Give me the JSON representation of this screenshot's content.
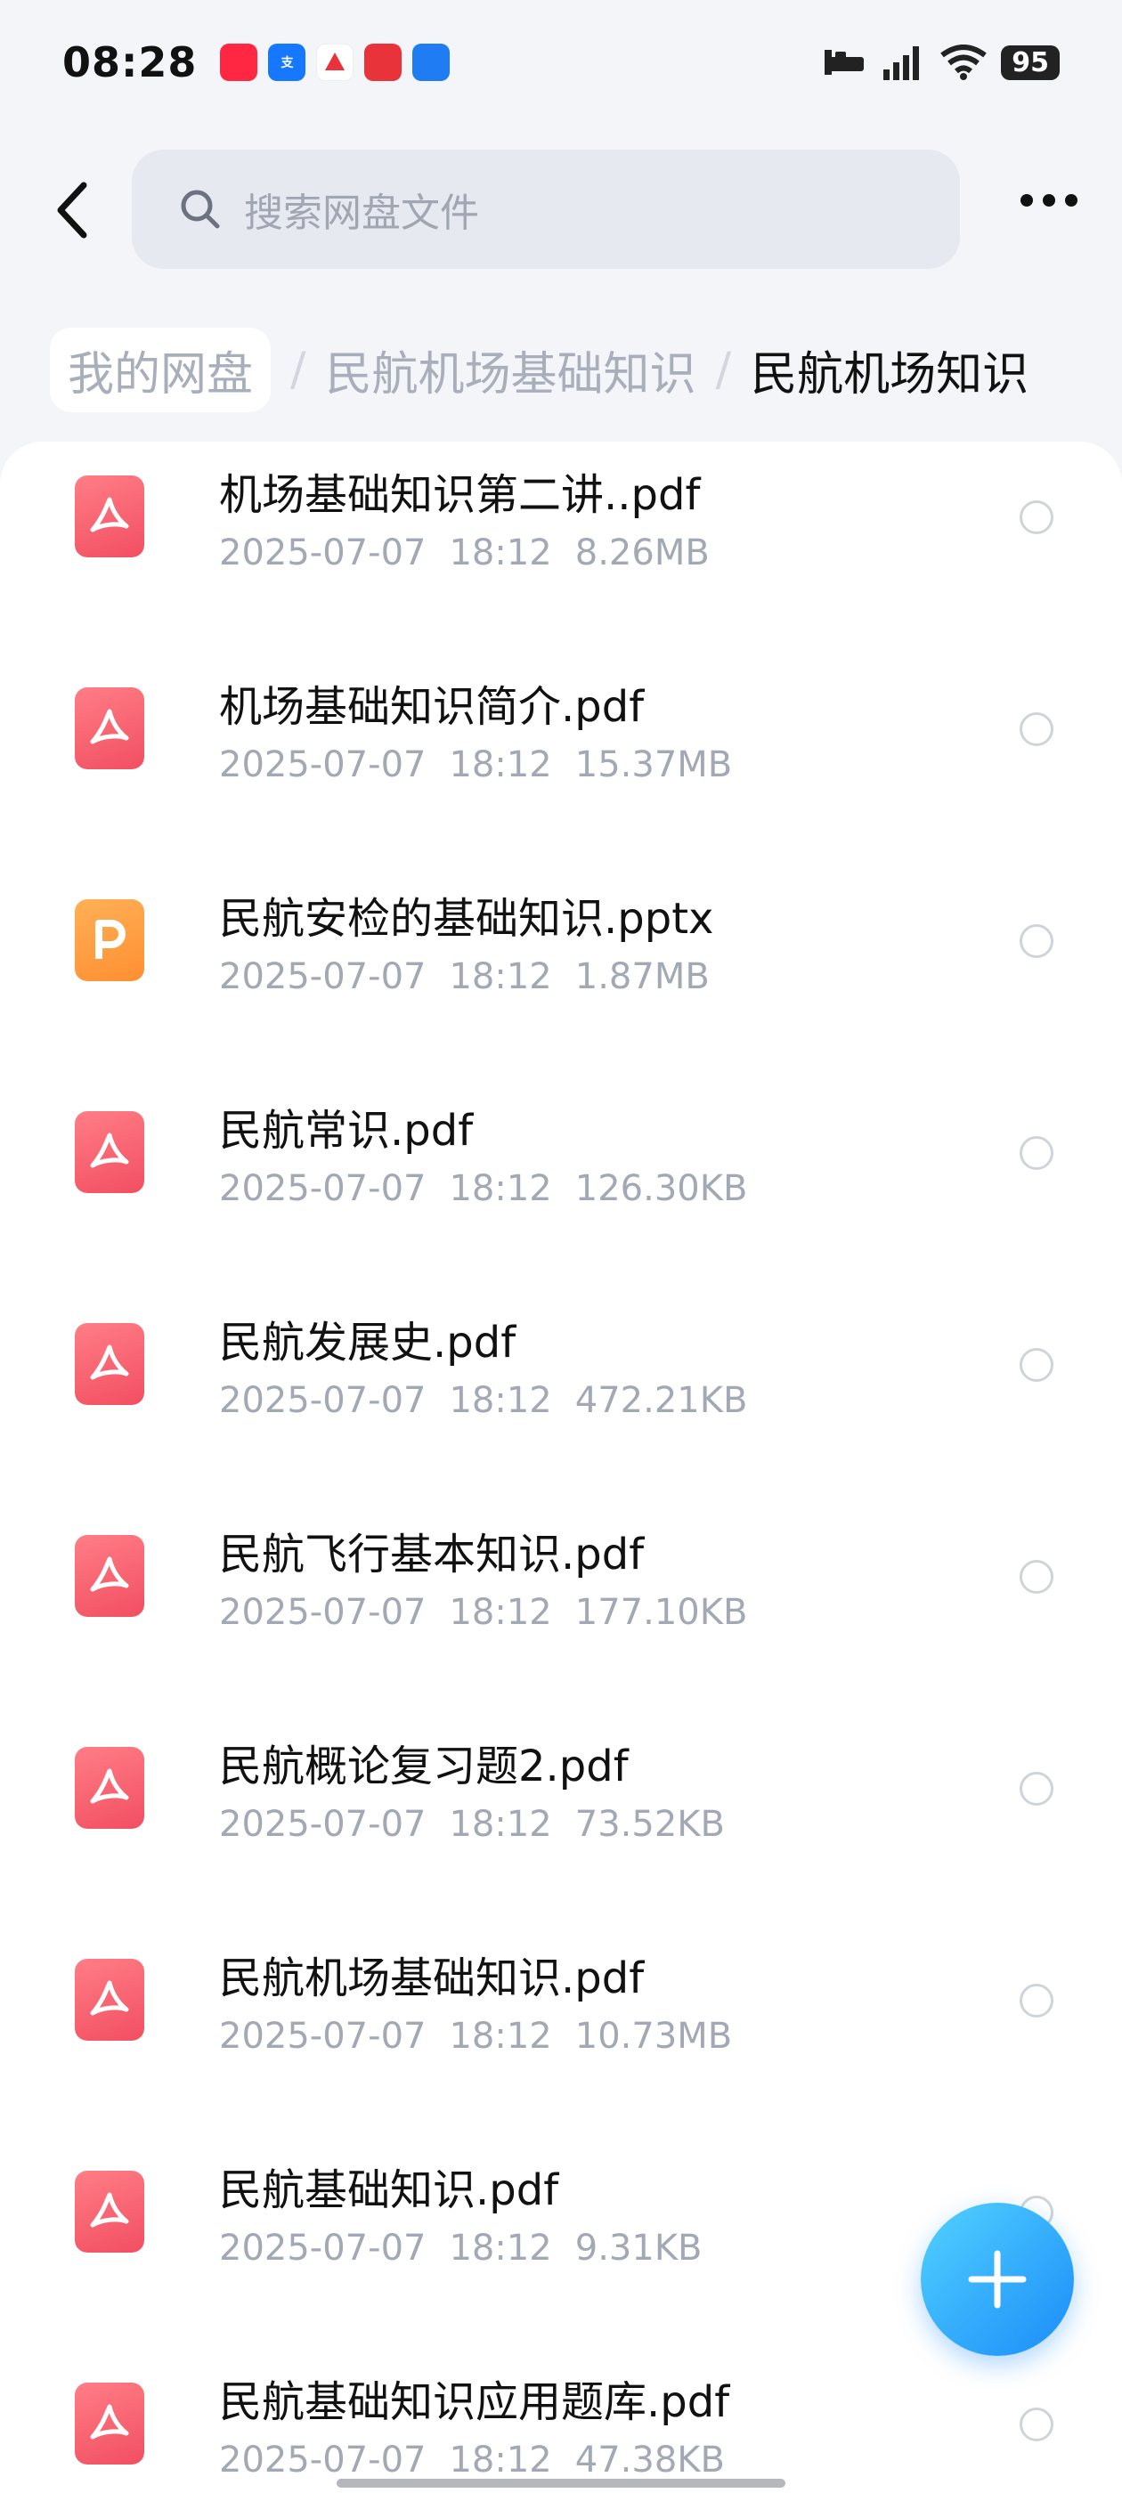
{
  "status_bar": {
    "time": "08:28",
    "battery": "95",
    "network": "4G",
    "notification_icons": [
      "xiaohongshu-icon",
      "alipay-icon",
      "app-icon-3",
      "app-icon-4",
      "app-icon-5"
    ]
  },
  "search": {
    "placeholder": "搜索网盘文件"
  },
  "breadcrumb": {
    "items": [
      "我的网盘",
      "民航机场基础知识",
      "民航机场知识"
    ],
    "separator": "/"
  },
  "files": [
    {
      "name": "机场基础知识第二讲..pdf",
      "date": "2025-07-07",
      "time": "18:12",
      "size": "8.26MB",
      "type": "pdf"
    },
    {
      "name": "机场基础知识简介.pdf",
      "date": "2025-07-07",
      "time": "18:12",
      "size": "15.37MB",
      "type": "pdf"
    },
    {
      "name": "民航安检的基础知识.pptx",
      "date": "2025-07-07",
      "time": "18:12",
      "size": "1.87MB",
      "type": "pptx"
    },
    {
      "name": "民航常识.pdf",
      "date": "2025-07-07",
      "time": "18:12",
      "size": "126.30KB",
      "type": "pdf"
    },
    {
      "name": "民航发展史.pdf",
      "date": "2025-07-07",
      "time": "18:12",
      "size": "472.21KB",
      "type": "pdf"
    },
    {
      "name": "民航飞行基本知识.pdf",
      "date": "2025-07-07",
      "time": "18:12",
      "size": "177.10KB",
      "type": "pdf"
    },
    {
      "name": "民航概论复习题2.pdf",
      "date": "2025-07-07",
      "time": "18:12",
      "size": "73.52KB",
      "type": "pdf"
    },
    {
      "name": "民航机场基础知识.pdf",
      "date": "2025-07-07",
      "time": "18:12",
      "size": "10.73MB",
      "type": "pdf"
    },
    {
      "name": "民航基础知识.pdf",
      "date": "2025-07-07",
      "time": "18:12",
      "size": "9.31KB",
      "type": "pdf"
    },
    {
      "name": "民航基础知识应用题库.pdf",
      "date": "2025-07-07",
      "time": "18:12",
      "size": "47.38KB",
      "type": "pdf"
    }
  ],
  "colors": {
    "pdf": "#f4566a",
    "pptx": "#ff9a3c",
    "accent": "#1f8ef8"
  },
  "icons": {
    "back": "back-arrow-icon",
    "search": "search-icon",
    "more": "more-icon",
    "add": "plus-icon"
  }
}
